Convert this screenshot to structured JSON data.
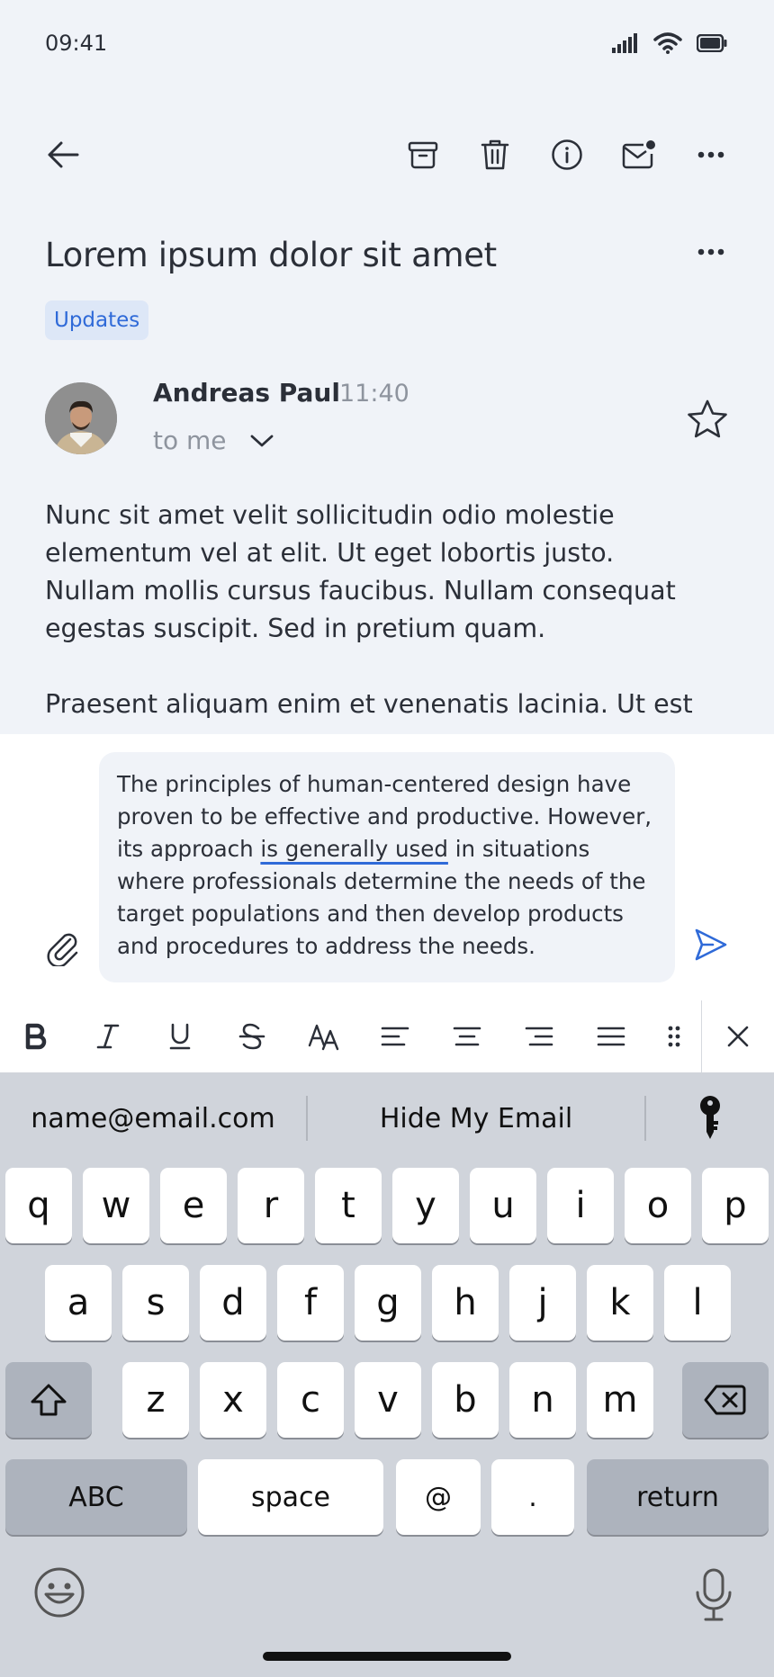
{
  "status": {
    "time": "09:41"
  },
  "email": {
    "subject": "Lorem ipsum dolor sit amet",
    "label": "Updates",
    "sender": "Andreas Paul",
    "time": "11:40",
    "recipient": "to me",
    "body": [
      "Nunc sit amet velit sollicitudin odio molestie elementum vel at elit. Ut eget lobortis justo. Nullam mollis cursus faucibus. Nullam consequat egestas suscipit. Sed in pretium quam.",
      "Praesent aliquam enim et venenatis lacinia. Ut est"
    ]
  },
  "compose": {
    "text_before": "The principles of human-centered design have proven to be effective and productive. However, its approach ",
    "text_marked": "is generally used",
    "text_after": " in situations where professionals determine the needs of the target populations and then develop products and procedures to address the needs."
  },
  "keyboard": {
    "suggestions": [
      "name@email.com",
      "Hide My Email"
    ],
    "row1": [
      "q",
      "w",
      "e",
      "r",
      "t",
      "y",
      "u",
      "i",
      "o",
      "p"
    ],
    "row2": [
      "a",
      "s",
      "d",
      "f",
      "g",
      "h",
      "j",
      "k",
      "l"
    ],
    "row3": [
      "z",
      "x",
      "c",
      "v",
      "b",
      "n",
      "m"
    ],
    "abc": "ABC",
    "space": "space",
    "at": "@",
    "dot": ".",
    "return": "return"
  },
  "colors": {
    "accent": "#2f6ad8",
    "background": "#f0f3f8",
    "keyboard": "#d0d4db"
  }
}
